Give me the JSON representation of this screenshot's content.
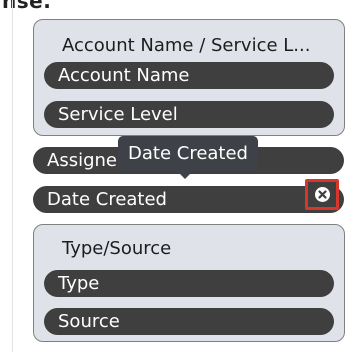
{
  "header_fragment": "nse.",
  "groups": [
    {
      "title": "Account Name / Service L...",
      "fields": [
        "Account Name",
        "Service Level"
      ]
    },
    {
      "title": "Type/Source",
      "fields": [
        "Type",
        "Source"
      ]
    }
  ],
  "standalone_fields": [
    "Assigne",
    "Date Created"
  ],
  "tooltip": "Date Created",
  "remove_icon": "close-icon",
  "colors": {
    "pill": "#3f3f3f",
    "group_background": "#dfe3e9",
    "highlight": "#d9362b",
    "tooltip": "#3e4248"
  }
}
